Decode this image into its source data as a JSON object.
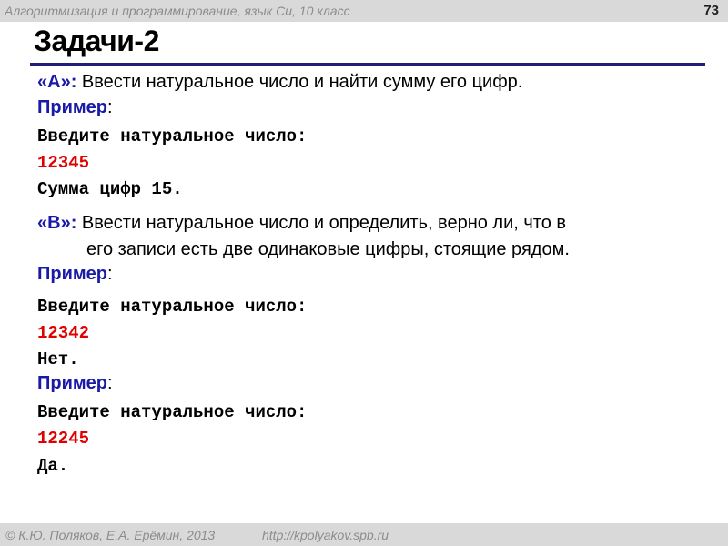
{
  "header": {
    "course": "Алгоритмизация и программирование, язык Си, 10 класс",
    "page_number": "73"
  },
  "title": "Задачи-2",
  "task_a": {
    "label": "«А»:",
    "text": " Ввести натуральное число и найти сумму его цифр.",
    "example_label": "Пример",
    "example": {
      "prompt": "Введите натуральное число:",
      "input": "12345",
      "output": "Сумма цифр 15."
    }
  },
  "task_b": {
    "label": "«B»:",
    "text_line1": " Ввести натуральное число и определить, верно ли, что в",
    "text_line2": "его записи есть две одинаковые цифры, стоящие рядом.",
    "examples": [
      {
        "label": "Пример",
        "prompt": "Введите натуральное число:",
        "input": "12342",
        "output": "Нет."
      },
      {
        "label": "Пример",
        "prompt": "Введите натуральное число:",
        "input": "12245",
        "output": "Да."
      }
    ]
  },
  "footer": {
    "copyright": "© К.Ю. Поляков, Е.А. Ерёмин, 2013",
    "url": "http://kpolyakov.spb.ru"
  },
  "colors": {
    "label": "#1a1aa8",
    "input": "#e00000",
    "rule": "#1f1f7a",
    "bars": "#d9d9d9"
  }
}
